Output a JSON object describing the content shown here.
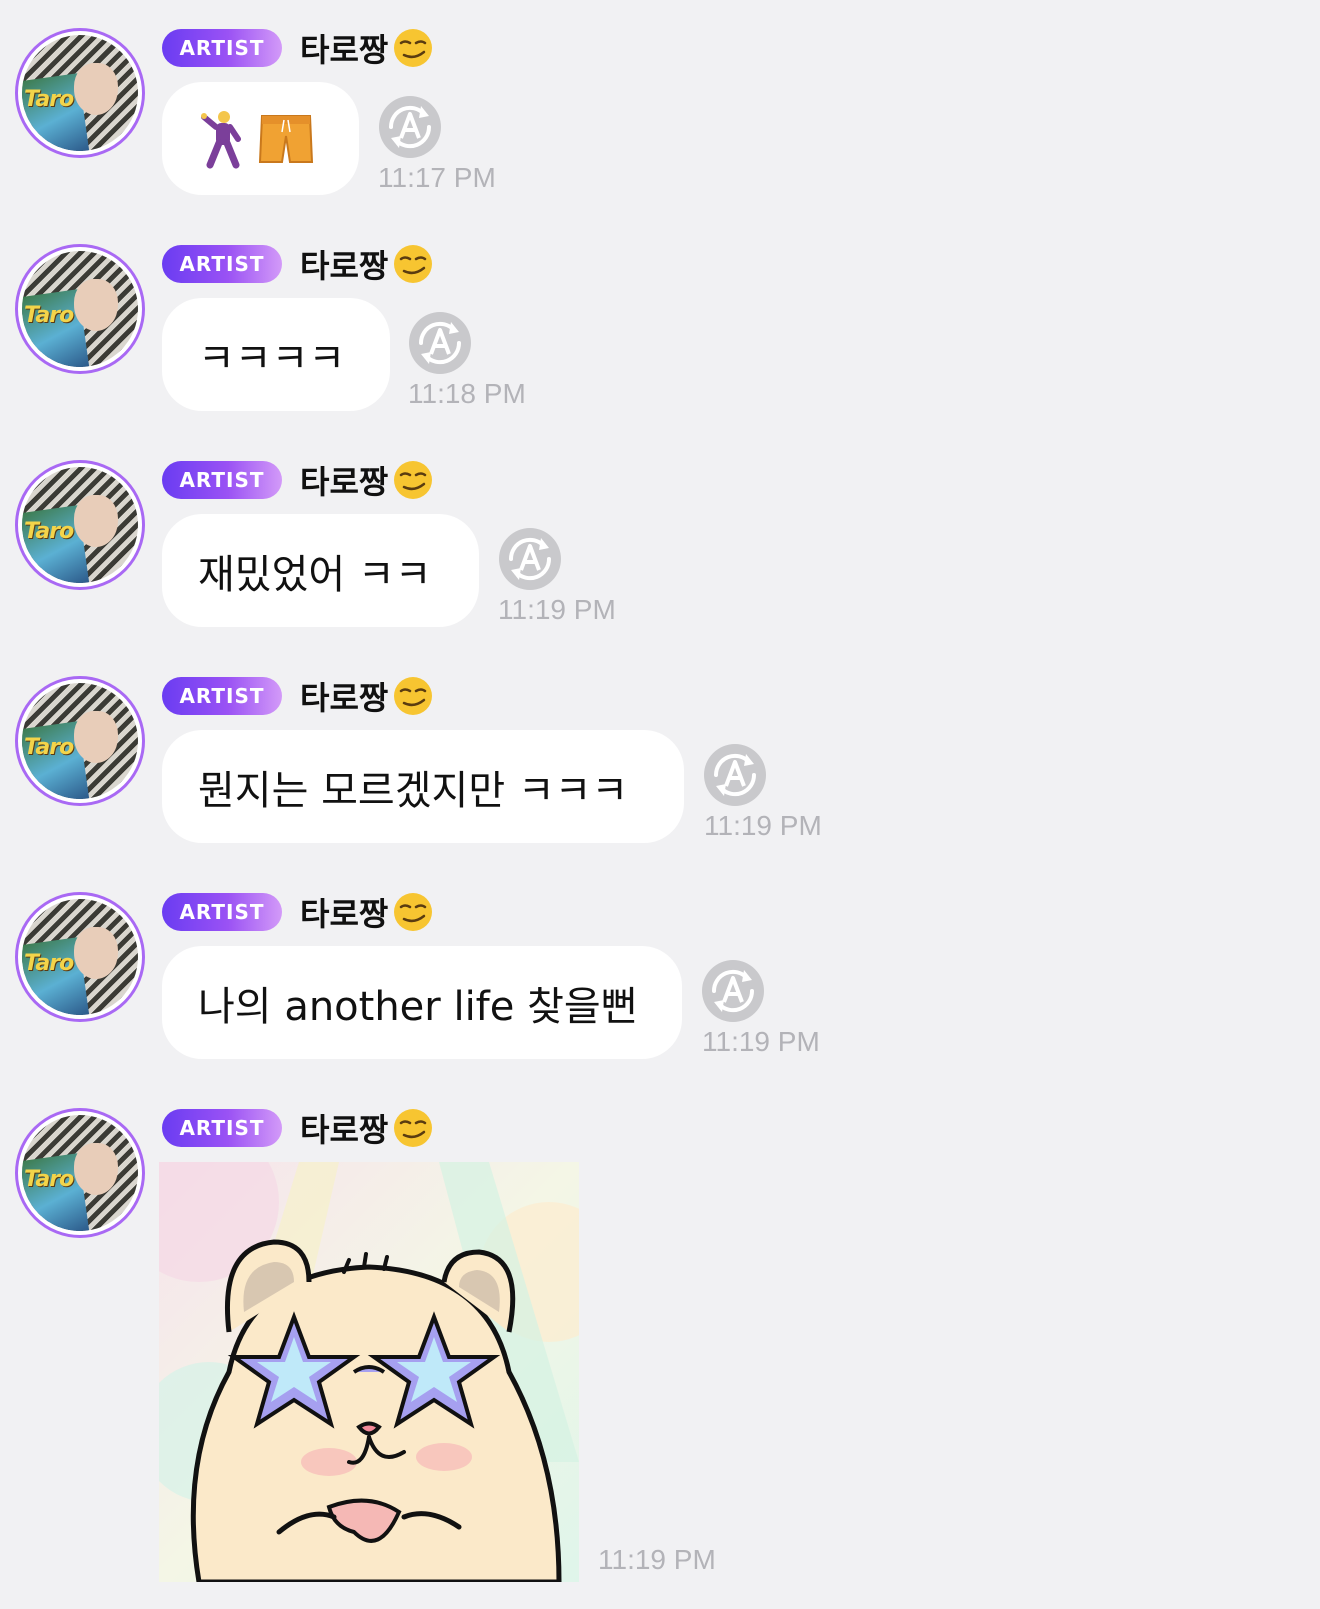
{
  "messages": [
    {
      "badge": "ARTIST",
      "name": "타로짱",
      "name_emoji": "smirking-face",
      "type": "emoji",
      "content": "🕺 🩳",
      "emoji_icons": [
        "man-dancing-icon",
        "shorts-icon"
      ],
      "time": "11:17 PM"
    },
    {
      "badge": "ARTIST",
      "name": "타로짱",
      "name_emoji": "smirking-face",
      "type": "text",
      "content": "ㅋㅋㅋㅋ",
      "time": "11:18 PM"
    },
    {
      "badge": "ARTIST",
      "name": "타로짱",
      "name_emoji": "smirking-face",
      "type": "text",
      "content": "재밌었어 ㅋㅋ",
      "time": "11:19 PM"
    },
    {
      "badge": "ARTIST",
      "name": "타로짱",
      "name_emoji": "smirking-face",
      "type": "text",
      "content": "뭔지는 모르겠지만 ㅋㅋㅋ",
      "time": "11:19 PM"
    },
    {
      "badge": "ARTIST",
      "name": "타로짱",
      "name_emoji": "smirking-face",
      "type": "text",
      "content": "나의 another life 찾을뻔",
      "time": "11:19 PM"
    },
    {
      "badge": "ARTIST",
      "name": "타로짱",
      "name_emoji": "smirking-face",
      "type": "sticker",
      "sticker": "hamster-star-sunglasses-sticker",
      "time": "11:19 PM"
    }
  ],
  "colors": {
    "background": "#f1f1f3",
    "badge_start": "#6a3cf2",
    "badge_end": "#d39af8",
    "avatar_ring": "#a969f4",
    "bubble": "#ffffff",
    "timestamp": "#b3b3b8",
    "translate_icon": "#c9c9cc"
  },
  "icons": {
    "translate": "translate-icon",
    "avatar": "avatar"
  }
}
